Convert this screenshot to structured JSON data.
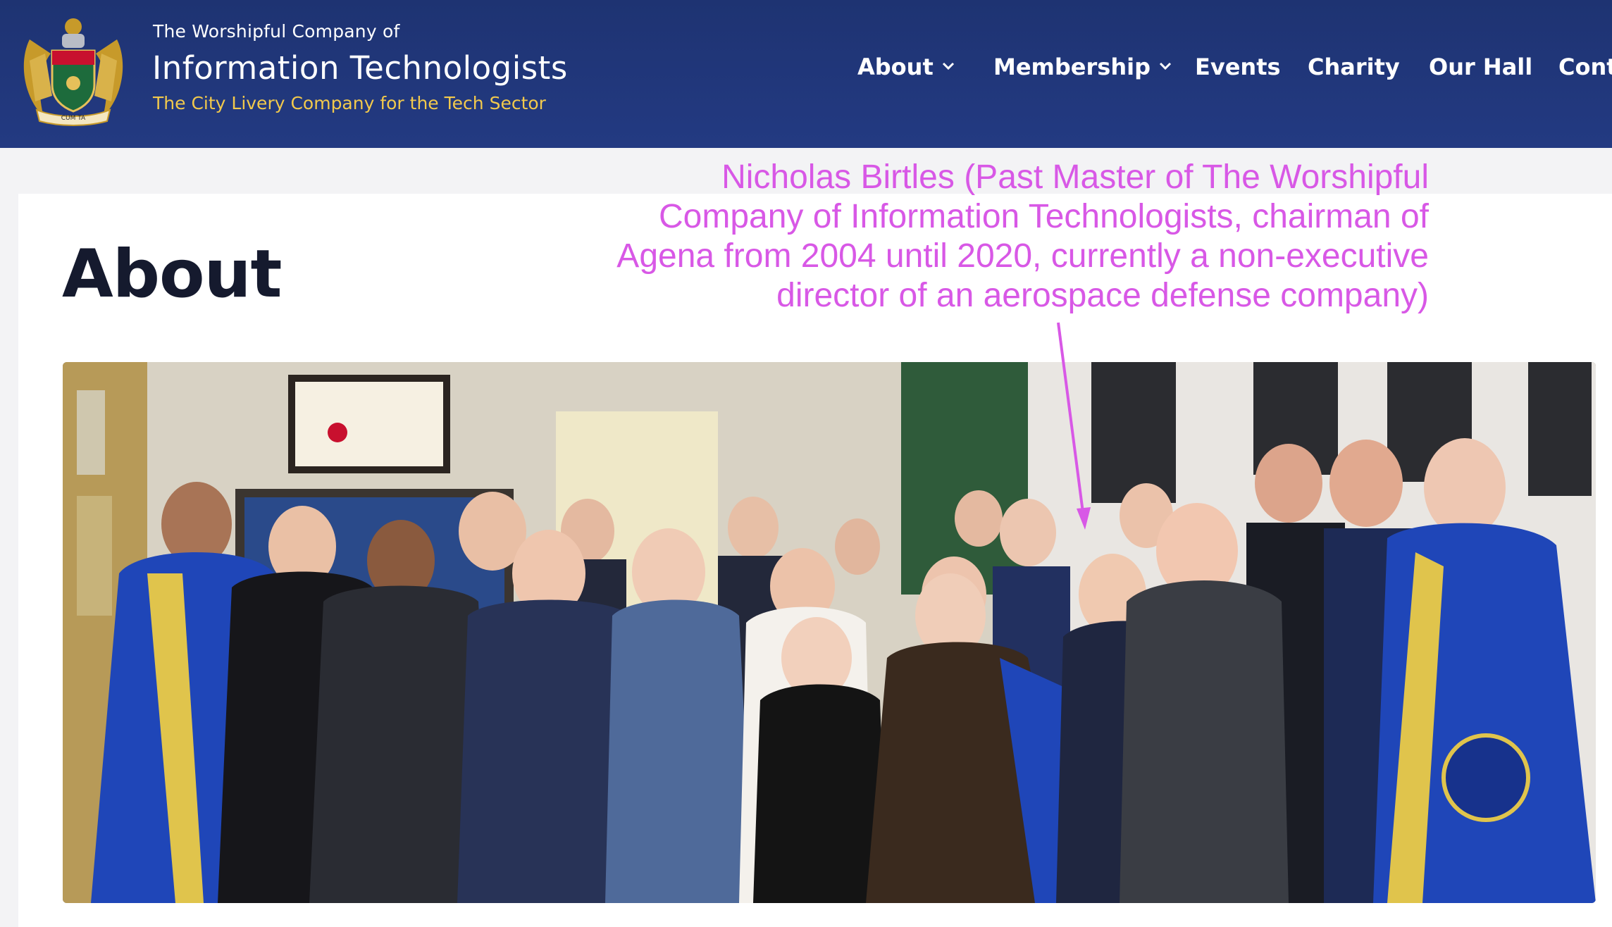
{
  "header": {
    "kicker": "The Worshipful Company of",
    "name": "Information Technologists",
    "tagline": "The City Livery Company for the Tech Sector",
    "crest_motto": "CUM TA"
  },
  "nav": {
    "items": [
      {
        "label": "About",
        "has_dropdown": true
      },
      {
        "label": "Membership",
        "has_dropdown": true
      },
      {
        "label": "Events",
        "has_dropdown": false
      },
      {
        "label": "Charity",
        "has_dropdown": false
      },
      {
        "label": "Our Hall",
        "has_dropdown": false
      },
      {
        "label": "Conta",
        "has_dropdown": false
      }
    ]
  },
  "page": {
    "title": "About"
  },
  "annotation": {
    "text": "Nicholas Birtles (Past Master of The Worshipful\nCompany of Information Technologists, chairman of\nAgena from 2004 until 2020, currently a non-executive\ndirector of an aerospace defense company)"
  },
  "colors": {
    "header_bg": "#1f3574",
    "tagline": "#f2c94c",
    "annotation": "#d858e6",
    "title": "#151a2e",
    "robe_blue": "#1f46b8"
  },
  "icons": {
    "crest": "coat-of-arms-icon",
    "dropdown": "chevron-down-icon"
  }
}
